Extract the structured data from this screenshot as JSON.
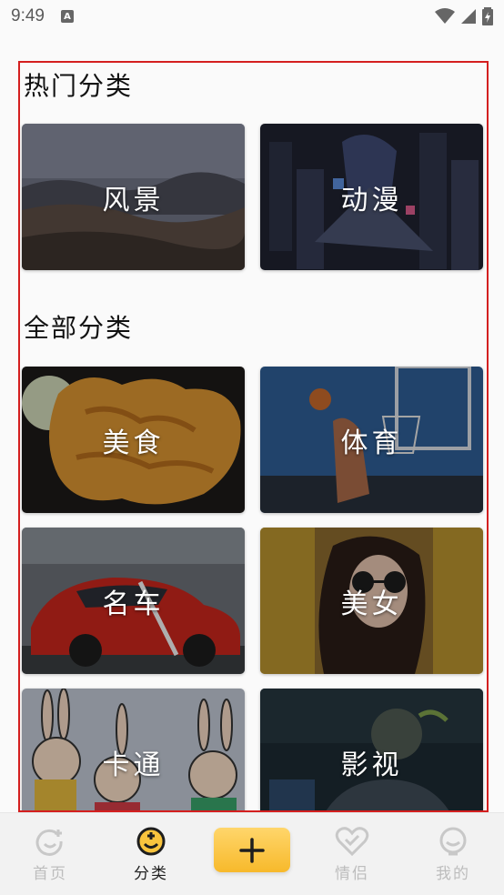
{
  "status_bar": {
    "time": "9:49",
    "notification_icon": "a-square-icon",
    "icons": [
      "wifi-icon",
      "signal-icon",
      "battery-charging-icon"
    ]
  },
  "hot_section": {
    "title": "热门分类",
    "cards": [
      {
        "label": "风景",
        "image": "landscape-photo"
      },
      {
        "label": "动漫",
        "image": "anime-photo"
      }
    ]
  },
  "all_section": {
    "title": "全部分类",
    "cards": [
      {
        "label": "美食",
        "image": "food-photo"
      },
      {
        "label": "体育",
        "image": "sports-photo"
      },
      {
        "label": "名车",
        "image": "car-photo"
      },
      {
        "label": "美女",
        "image": "portrait-photo"
      },
      {
        "label": "卡通",
        "image": "cartoon-photo"
      },
      {
        "label": "影视",
        "image": "movie-photo"
      }
    ]
  },
  "bottom_nav": {
    "items": [
      {
        "label": "首页",
        "icon": "home-face-icon",
        "active": false
      },
      {
        "label": "分类",
        "icon": "category-face-icon",
        "active": true
      },
      {
        "label": "情侣",
        "icon": "heart-icon",
        "active": false
      },
      {
        "label": "我的",
        "icon": "profile-icon",
        "active": false
      }
    ],
    "add_button": {
      "icon": "plus-icon"
    },
    "colors": {
      "active": "#222222",
      "inactive": "#bdbdbd",
      "accent": "#f9c43d"
    }
  },
  "frame_color": "#d41f1f"
}
